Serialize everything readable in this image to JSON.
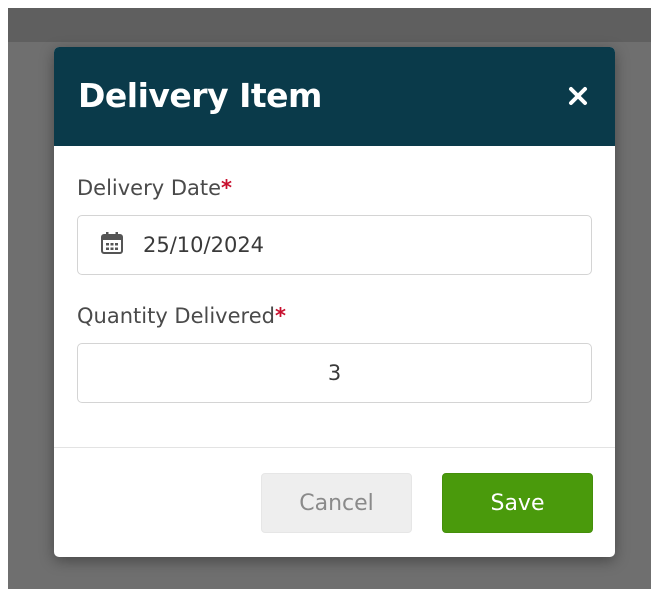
{
  "dialog": {
    "title": "Delivery Item",
    "close_icon": "close-icon",
    "header_color": "#0a3a4a"
  },
  "form": {
    "delivery_date": {
      "label": "Delivery Date",
      "required_marker": "*",
      "value": "25/10/2024",
      "icon": "calendar-icon"
    },
    "quantity_delivered": {
      "label": "Quantity Delivered",
      "required_marker": "*",
      "value": "3"
    }
  },
  "footer": {
    "cancel_label": "Cancel",
    "save_label": "Save",
    "save_color": "#4a9a0c"
  }
}
